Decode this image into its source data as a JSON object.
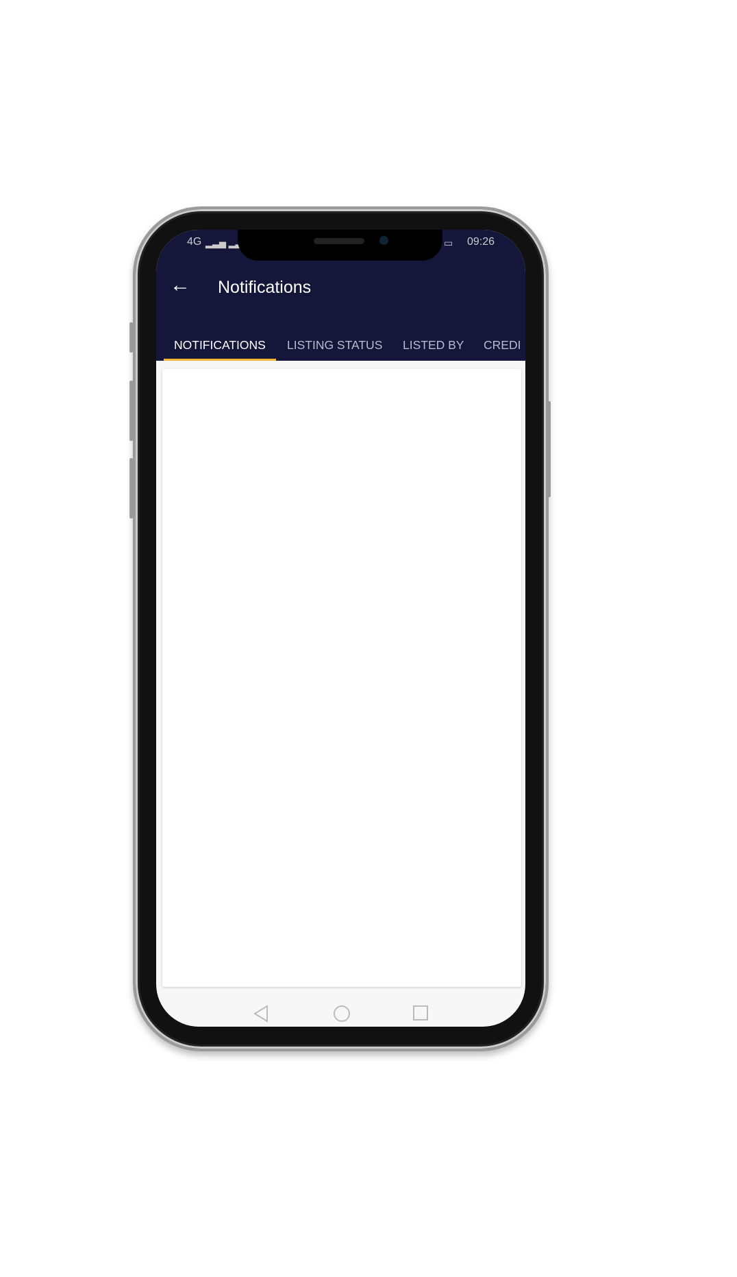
{
  "status_bar": {
    "network": "4G",
    "time": "09:26",
    "icons": [
      "signal-icon",
      "signal-icon",
      "whatsapp-icon",
      "battery-icon"
    ]
  },
  "app_bar": {
    "title": "Notifications",
    "back_icon": "arrow-left-icon"
  },
  "tabs": [
    {
      "label": "NOTIFICATIONS",
      "active": true
    },
    {
      "label": "LISTING STATUS",
      "active": false
    },
    {
      "label": "LISTED BY",
      "active": false
    },
    {
      "label": "CREDI",
      "active": false
    }
  ],
  "colors": {
    "header": "#15173a",
    "tab_indicator": "#f4b632"
  },
  "nav_bar": [
    "back-triangle-icon",
    "home-circle-icon",
    "recents-square-icon"
  ]
}
